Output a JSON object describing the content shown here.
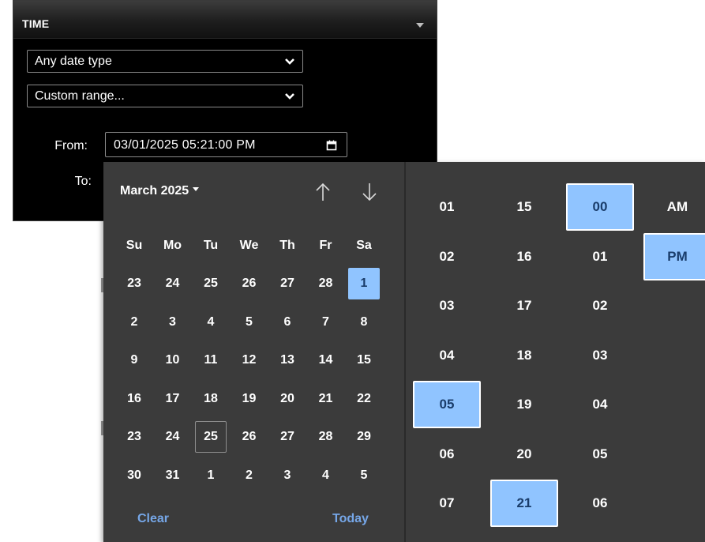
{
  "panel": {
    "title": "TIME",
    "date_type_select": "Any date type",
    "range_select": "Custom range...",
    "from_label": "From:",
    "to_label": "To:",
    "from_value": "03/01/2025 05:21:00 PM"
  },
  "picker": {
    "month_label": "March 2025",
    "weekdays": [
      "Su",
      "Mo",
      "Tu",
      "We",
      "Th",
      "Fr",
      "Sa"
    ],
    "weeks": [
      [
        "23",
        "24",
        "25",
        "26",
        "27",
        "28",
        "1"
      ],
      [
        "2",
        "3",
        "4",
        "5",
        "6",
        "7",
        "8"
      ],
      [
        "9",
        "10",
        "11",
        "12",
        "13",
        "14",
        "15"
      ],
      [
        "16",
        "17",
        "18",
        "19",
        "20",
        "21",
        "22"
      ],
      [
        "23",
        "24",
        "25",
        "26",
        "27",
        "28",
        "29"
      ],
      [
        "30",
        "31",
        "1",
        "2",
        "3",
        "4",
        "5"
      ]
    ],
    "selected_day": "1",
    "today_day": "25",
    "clear_label": "Clear",
    "today_label": "Today",
    "hours": [
      "01",
      "02",
      "03",
      "04",
      "05",
      "06",
      "07"
    ],
    "minutes": [
      "15",
      "16",
      "17",
      "18",
      "19",
      "20",
      "21"
    ],
    "seconds": [
      "00",
      "01",
      "02",
      "03",
      "04",
      "05",
      "06"
    ],
    "ampm": [
      "AM",
      "PM"
    ],
    "selected_hour": "05",
    "selected_minute": "21",
    "selected_second": "00",
    "selected_ampm": "PM"
  },
  "colors": {
    "accent": "#90c4ff",
    "link": "#76a7e8",
    "popup_bg": "#3b3b3b"
  }
}
